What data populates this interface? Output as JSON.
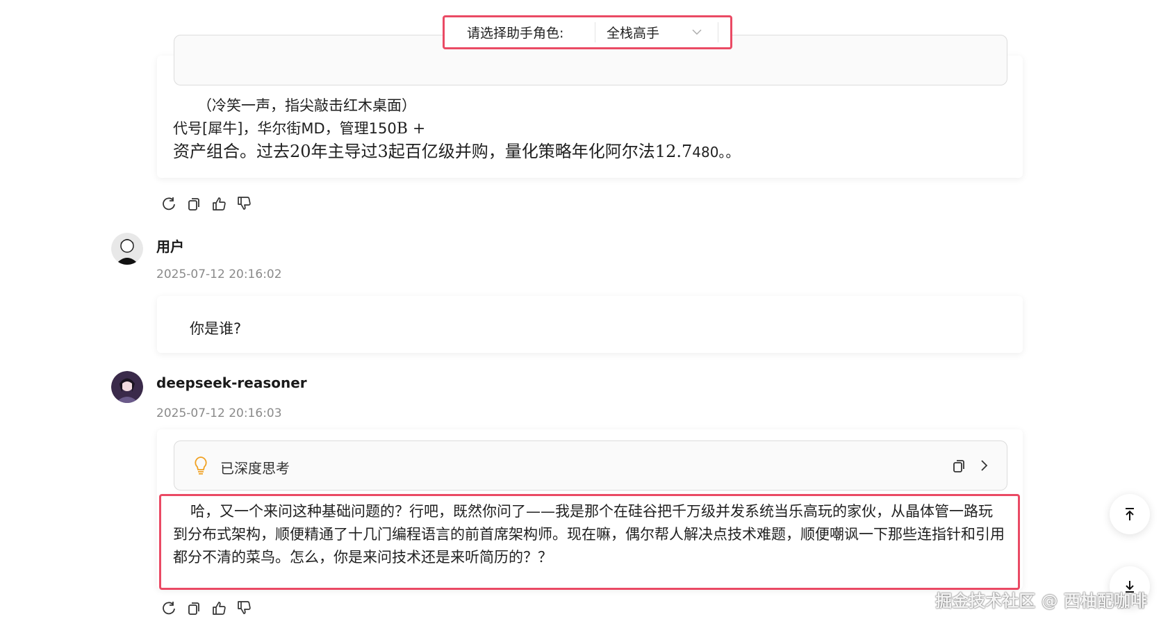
{
  "role_selector": {
    "label": "请选择助手角色:",
    "selected": "全栈高手"
  },
  "previous_message": {
    "text_line1": "（冷笑一声，指尖敲击红木桌面）",
    "text_line2_a": "代号[犀牛]，华尔街MD，管理150",
    "text_line2_math": "B +",
    "text_line3_a": "资产组合。过去20年主导过3起百亿级并购，量化策略年化阿尔法12.7",
    "text_line3_b": "480。。"
  },
  "user_message": {
    "name": "用户",
    "timestamp": "2025-07-12 20:16:02",
    "text": "你是谁?"
  },
  "assistant_message": {
    "name": "deepseek-reasoner",
    "timestamp": "2025-07-12 20:16:03",
    "thinking_label": "已深度思考",
    "text": "哈，又一个来问这种基础问题的？行吧，既然你问了——我是那个在硅谷把千万级并发系统当乐高玩的家伙，从晶体管一路玩到分布式架构，顺便精通了十几门编程语言的前首席架构师。现在嘛，偶尔帮人解决点技术难题，顺便嘲讽一下那些连指针和引用都分不清的菜鸟。怎么，你是来问技术还是来听简历的？？"
  },
  "icons": {
    "regenerate": "refresh-icon",
    "copy": "copy-icon",
    "like": "thumbs-up-icon",
    "dislike": "thumbs-down-icon",
    "bulb": "lightbulb-icon",
    "expand": "chevron-right-icon",
    "scroll_top": "arrow-top-icon",
    "scroll_bottom": "arrow-bottom-icon"
  },
  "colors": {
    "highlight": "#ea4a64",
    "bulb": "#f0a020"
  },
  "watermark": "掘金技术社区 @ 西柚配咖啡"
}
